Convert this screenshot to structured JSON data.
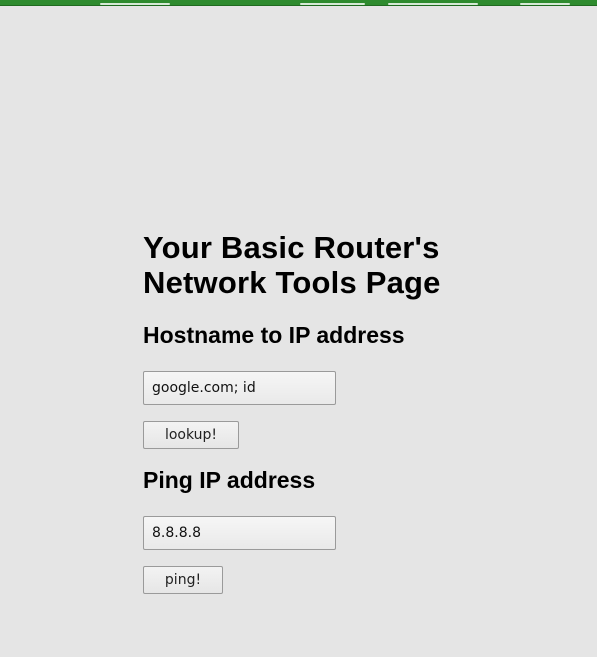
{
  "page": {
    "title": "Your Basic Router's Network Tools Page"
  },
  "hostname_section": {
    "heading": "Hostname to IP address",
    "input_value": "google.com; id",
    "button_label": "lookup!"
  },
  "ping_section": {
    "heading": "Ping IP address",
    "input_value": "8.8.8.8",
    "button_label": "ping!"
  },
  "colors": {
    "background": "#e5e5e5",
    "top_bar": "#2e8b2e"
  }
}
